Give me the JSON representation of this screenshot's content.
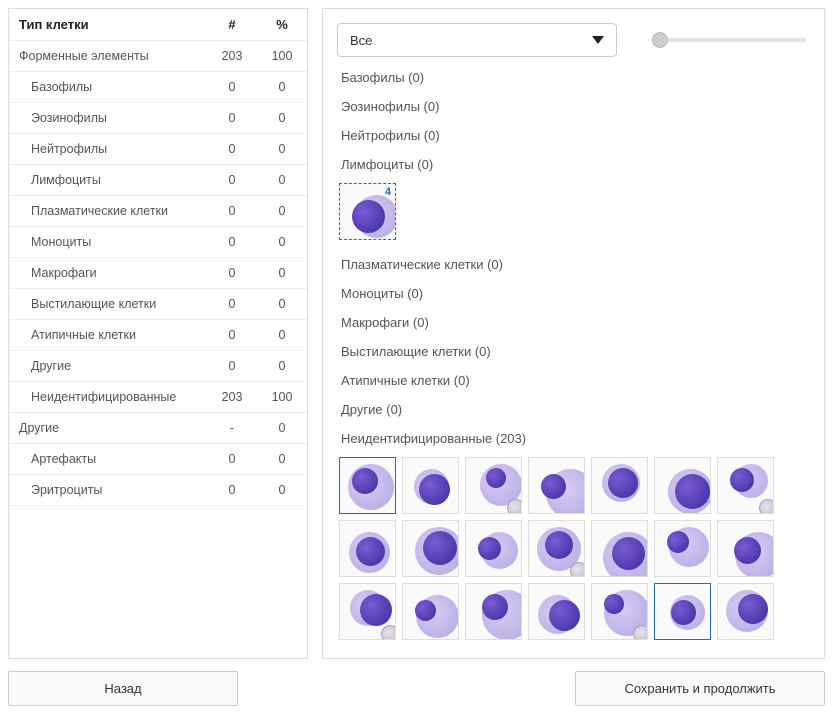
{
  "table": {
    "headers": {
      "type": "Тип клетки",
      "count": "#",
      "percent": "%"
    },
    "rows": [
      {
        "label": "Форменные элементы",
        "count": "203",
        "percent": "100",
        "indent": false
      },
      {
        "label": "Базофилы",
        "count": "0",
        "percent": "0",
        "indent": true
      },
      {
        "label": "Эозинофилы",
        "count": "0",
        "percent": "0",
        "indent": true
      },
      {
        "label": "Нейтрофилы",
        "count": "0",
        "percent": "0",
        "indent": true
      },
      {
        "label": "Лимфоциты",
        "count": "0",
        "percent": "0",
        "indent": true
      },
      {
        "label": "Плазматические клетки",
        "count": "0",
        "percent": "0",
        "indent": true
      },
      {
        "label": "Моноциты",
        "count": "0",
        "percent": "0",
        "indent": true
      },
      {
        "label": "Макрофаги",
        "count": "0",
        "percent": "0",
        "indent": true
      },
      {
        "label": "Выстилающие клетки",
        "count": "0",
        "percent": "0",
        "indent": true
      },
      {
        "label": "Атипичные клетки",
        "count": "0",
        "percent": "0",
        "indent": true
      },
      {
        "label": "Другие",
        "count": "0",
        "percent": "0",
        "indent": true
      },
      {
        "label": "Неидентифицированные",
        "count": "203",
        "percent": "100",
        "indent": true
      },
      {
        "label": "Другие",
        "count": "-",
        "percent": "0",
        "indent": false
      },
      {
        "label": "Артефакты",
        "count": "0",
        "percent": "0",
        "indent": true
      },
      {
        "label": "Эритроциты",
        "count": "0",
        "percent": "0",
        "indent": true
      }
    ]
  },
  "filter": {
    "selected": "Все"
  },
  "groups": [
    {
      "label": "Базофилы (0)",
      "thumbs": 0
    },
    {
      "label": "Эозинофилы (0)",
      "thumbs": 0
    },
    {
      "label": "Нейтрофилы (0)",
      "thumbs": 0
    },
    {
      "label": "Лимфоциты (0)",
      "thumbs": 1,
      "selected_badge": "4"
    },
    {
      "label": "Плазматические клетки (0)",
      "thumbs": 0
    },
    {
      "label": "Моноциты (0)",
      "thumbs": 0
    },
    {
      "label": "Макрофаги (0)",
      "thumbs": 0
    },
    {
      "label": "Выстилающие клетки (0)",
      "thumbs": 0
    },
    {
      "label": "Атипичные клетки (0)",
      "thumbs": 0
    },
    {
      "label": "Другие (0)",
      "thumbs": 0
    },
    {
      "label": "Неидентифицированные (203)",
      "thumbs": 21
    }
  ],
  "buttons": {
    "back": "Назад",
    "save": "Сохранить и продолжить"
  }
}
